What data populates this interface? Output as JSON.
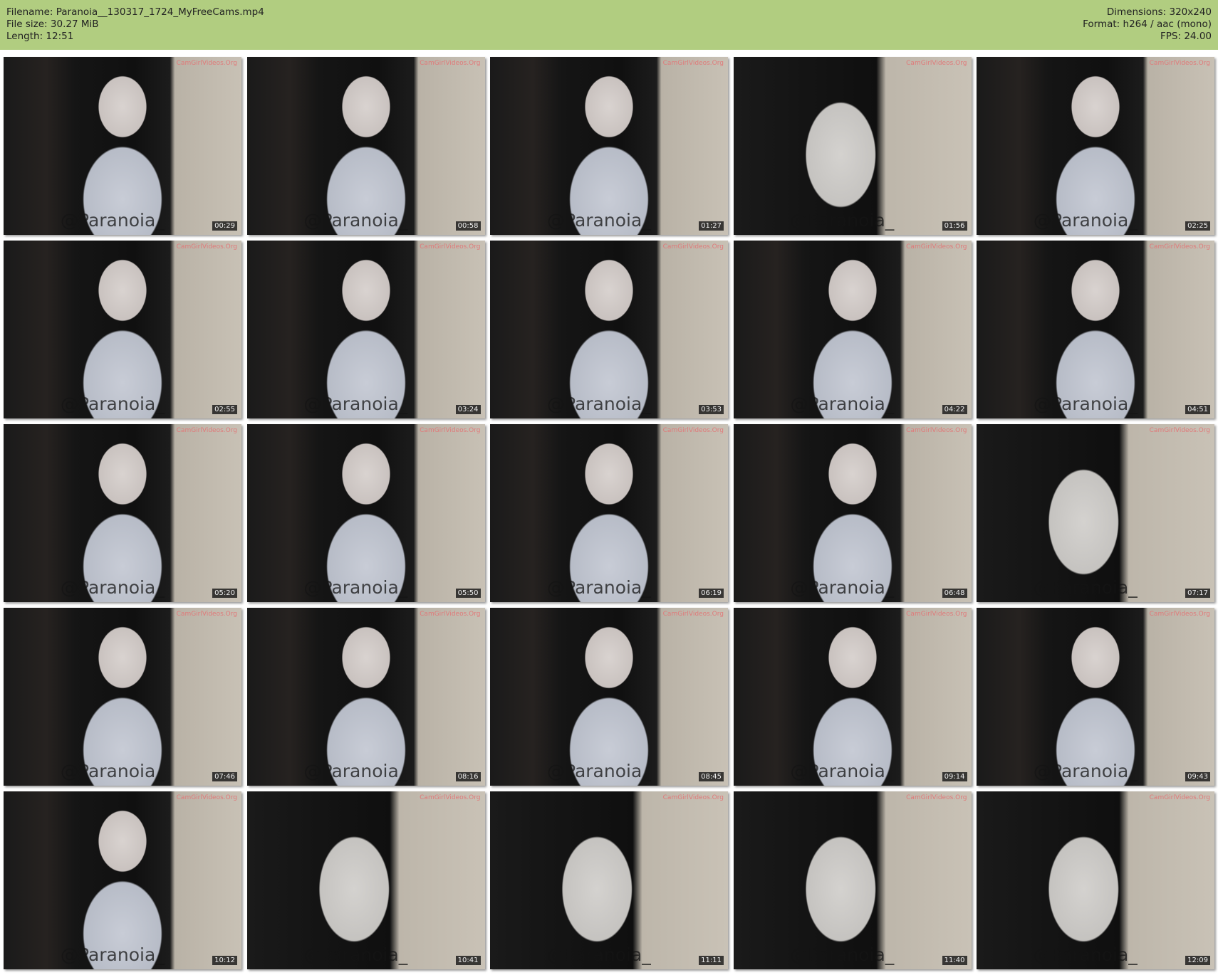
{
  "header": {
    "filename": "Filename: Paranoia__130317_1724_MyFreeCams.mp4",
    "filesize": "File size: 30.27 MiB",
    "length": "Length: 12:51",
    "dimensions": "Dimensions: 320x240",
    "format": "Format: h264 / aac (mono)",
    "fps": "FPS: 24.00"
  },
  "watermark": "CamGirlVideos.Org",
  "overlay_text": "@Paranoia_",
  "thumbnails": [
    {
      "time": "00:29"
    },
    {
      "time": "00:58"
    },
    {
      "time": "01:27"
    },
    {
      "time": "01:56"
    },
    {
      "time": "02:25"
    },
    {
      "time": "02:55"
    },
    {
      "time": "03:24"
    },
    {
      "time": "03:53"
    },
    {
      "time": "04:22"
    },
    {
      "time": "04:51"
    },
    {
      "time": "05:20"
    },
    {
      "time": "05:50"
    },
    {
      "time": "06:19"
    },
    {
      "time": "06:48"
    },
    {
      "time": "07:17"
    },
    {
      "time": "07:46"
    },
    {
      "time": "08:16"
    },
    {
      "time": "08:45"
    },
    {
      "time": "09:14"
    },
    {
      "time": "09:43"
    },
    {
      "time": "10:12"
    },
    {
      "time": "10:41"
    },
    {
      "time": "11:11"
    },
    {
      "time": "11:40"
    },
    {
      "time": "12:09"
    }
  ]
}
